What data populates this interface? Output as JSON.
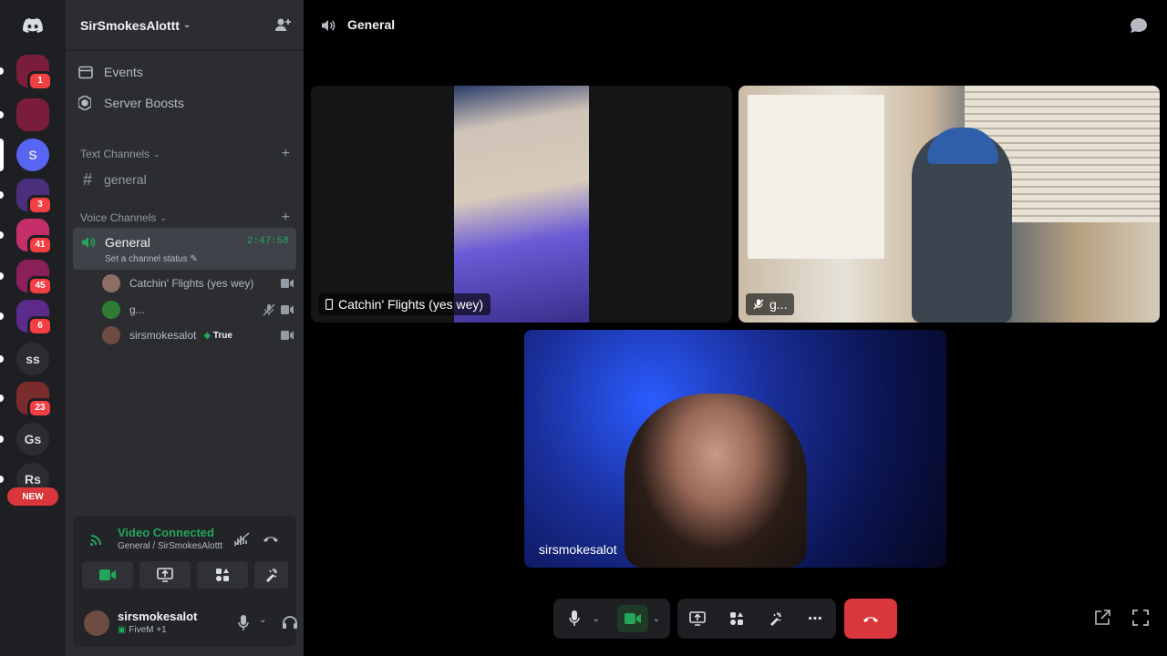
{
  "rail": {
    "servers": [
      {
        "kind": "img",
        "color": "#7a1d3a",
        "badge": "1"
      },
      {
        "kind": "img",
        "color": "#7a1d3a",
        "badge": ""
      },
      {
        "kind": "letter",
        "label": "S",
        "color": "#5865f2",
        "badge": ""
      },
      {
        "kind": "img",
        "color": "#4a2f7a",
        "badge": "3"
      },
      {
        "kind": "img",
        "color": "#c42f6a",
        "badge": "41"
      },
      {
        "kind": "img",
        "color": "#8a1f5a",
        "badge": "45"
      },
      {
        "kind": "img",
        "color": "#5b2a8a",
        "badge": "6"
      },
      {
        "kind": "letter",
        "label": "ss",
        "color": "#2b2d31",
        "badge": ""
      },
      {
        "kind": "img",
        "color": "#7a2c2c",
        "badge": "23"
      },
      {
        "kind": "letter",
        "label": "Gs",
        "color": "#2b2d31",
        "badge": ""
      },
      {
        "kind": "letter",
        "label": "Rs",
        "color": "#2b2d31",
        "badge": ""
      }
    ],
    "new_badge": "NEW"
  },
  "sidebar": {
    "guild_name": "SirSmokesAlottt",
    "links": [
      {
        "label": "Events",
        "icon": "calendar-icon"
      },
      {
        "label": "Server Boosts",
        "icon": "boost-icon"
      }
    ],
    "text_category": "Text Channels",
    "text_channels": [
      {
        "label": "general"
      }
    ],
    "voice_category": "Voice Channels",
    "voice_channel": {
      "name": "General",
      "timer": "2:47:58",
      "status": "Set a channel status"
    },
    "members": [
      {
        "name": "Catchin' Flights (yes wey)",
        "color": "#8d6e63",
        "muted": false,
        "tag": ""
      },
      {
        "name": "g...",
        "color": "#2e7d32",
        "muted": true,
        "tag": ""
      },
      {
        "name": "sirsmokesalot",
        "color": "#6d4c41",
        "muted": false,
        "tag": "True"
      }
    ]
  },
  "voice_panel": {
    "title": "Video Connected",
    "subtitle": "General / SirSmokesAlottt"
  },
  "user": {
    "name": "sirsmokesalot",
    "status": "FiveM +1"
  },
  "main": {
    "title": "General",
    "tiles": [
      {
        "label": "Catchin' Flights (yes wey)"
      },
      {
        "label": "g..."
      },
      {
        "label": "sirsmokesalot"
      }
    ]
  },
  "colors": {
    "accent": "#5865f2",
    "online": "#23a55a",
    "danger": "#da373c"
  }
}
